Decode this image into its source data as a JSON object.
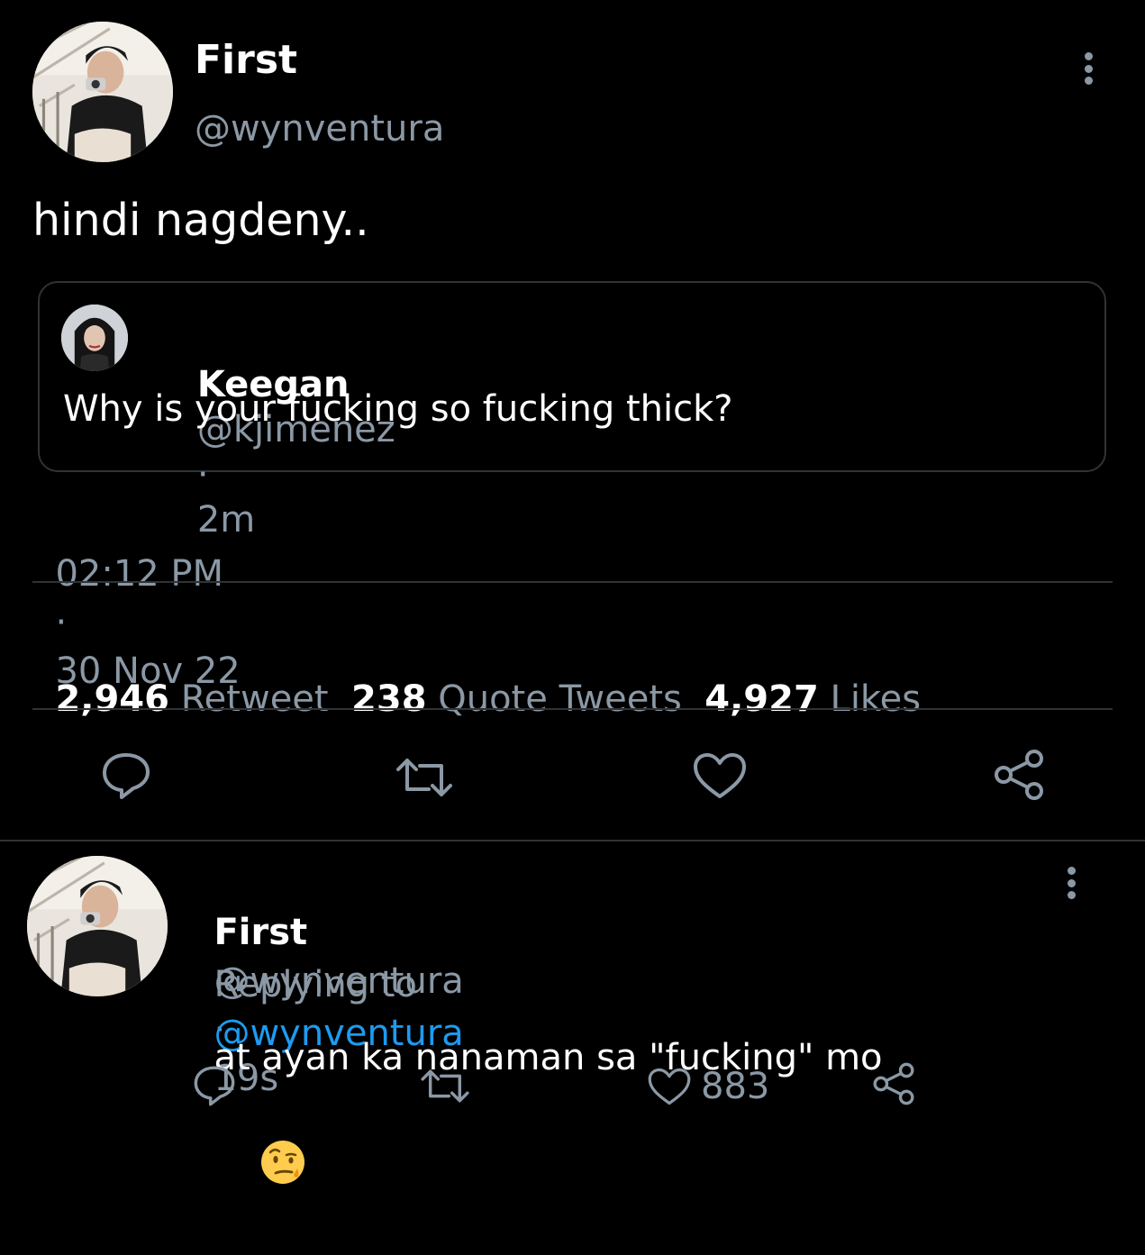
{
  "main_tweet": {
    "display_name": "First",
    "handle": "@wynventura",
    "text": "hindi nagdeny..",
    "timestamp": "02:12 PM",
    "separator": "·",
    "date": "30 Nov 22",
    "quoted": {
      "display_name": "Keegan",
      "handle": "@kjimenez",
      "separator": "·",
      "age": "2m",
      "text": "Why is your fucking so fucking thick?"
    },
    "stats": {
      "retweets_count": "2,946",
      "retweets_label": "Retweet",
      "quotes_count": "238",
      "quotes_label": "Quote Tweets",
      "likes_count": "4,927",
      "likes_label": "Likes"
    },
    "actions": [
      "reply-icon",
      "retweet-icon",
      "like-icon",
      "share-icon"
    ]
  },
  "reply_tweet": {
    "display_name": "First",
    "handle": "@wynventura",
    "separator": "·",
    "age": "19s",
    "replying_to_label": "Replying to",
    "replying_to_handle": "@wynventura",
    "text": "at ayan ka nanaman sa \"fucking\" mo",
    "emoji": "face-with-raised-eyebrow",
    "likes_count": "883",
    "actions": [
      "reply-icon",
      "retweet-icon",
      "like-icon",
      "share-icon"
    ]
  },
  "colors": {
    "background": "#000000",
    "primary_text": "#ffffff",
    "secondary_text": "#8b98a5",
    "link": "#1d9bf0",
    "border": "#2f3336"
  }
}
